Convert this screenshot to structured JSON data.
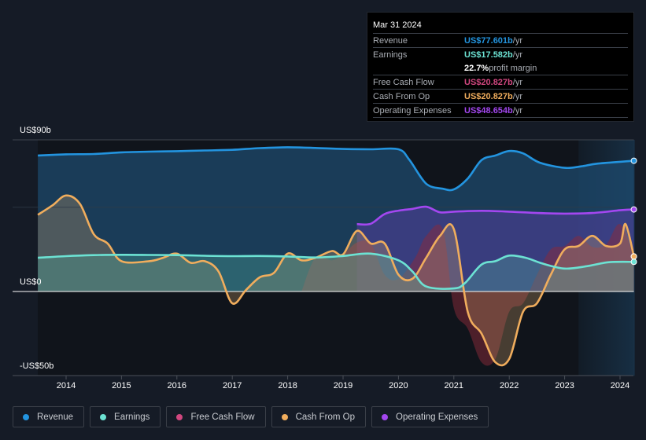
{
  "tooltip": {
    "date": "Mar 31 2024",
    "rows": [
      {
        "label": "Revenue",
        "value": "US$77.601b",
        "unit": " /yr",
        "color": "#2394df"
      },
      {
        "label": "Earnings",
        "value": "US$17.582b",
        "unit": " /yr",
        "color": "#6ce2d3"
      },
      {
        "label": "",
        "value": "22.7%",
        "unit": " profit margin",
        "color": "#ffffff"
      },
      {
        "label": "Free Cash Flow",
        "value": "US$20.827b",
        "unit": " /yr",
        "color": "#d1477f"
      },
      {
        "label": "Cash From Op",
        "value": "US$20.827b",
        "unit": " /yr",
        "color": "#f0ad5d"
      },
      {
        "label": "Operating Expenses",
        "value": "US$48.654b",
        "unit": " /yr",
        "color": "#a347f0"
      }
    ]
  },
  "legend": [
    {
      "label": "Revenue",
      "color": "#2394df"
    },
    {
      "label": "Earnings",
      "color": "#6ce2d3"
    },
    {
      "label": "Free Cash Flow",
      "color": "#d1477f"
    },
    {
      "label": "Cash From Op",
      "color": "#f0ad5d"
    },
    {
      "label": "Operating Expenses",
      "color": "#a347f0"
    }
  ],
  "chart_data": {
    "type": "area",
    "title": "",
    "xlabel": "",
    "ylabel": "",
    "ylim": [
      -50,
      90
    ],
    "xlim": [
      2013.5,
      2024.25
    ],
    "y_tick_labels": [
      {
        "value": 90,
        "label": "US$90b"
      },
      {
        "value": 0,
        "label": "US$0"
      },
      {
        "value": -50,
        "label": "-US$50b"
      }
    ],
    "x_ticks": [
      2014,
      2015,
      2016,
      2017,
      2018,
      2019,
      2020,
      2021,
      2022,
      2023,
      2024
    ],
    "x_tick_labels": [
      "2014",
      "2015",
      "2016",
      "2017",
      "2018",
      "2019",
      "2020",
      "2021",
      "2022",
      "2023",
      "2024"
    ],
    "gridlines": [
      90,
      50,
      0
    ],
    "forecast_shade_start": 2023.25,
    "legend_position": "bottom",
    "series": [
      {
        "name": "Revenue",
        "color": "#2394df",
        "points": [
          [
            2013.49,
            80.7
          ],
          [
            2014,
            81.4
          ],
          [
            2014.5,
            81.6
          ],
          [
            2015,
            82.6
          ],
          [
            2015.5,
            83
          ],
          [
            2016,
            83.3
          ],
          [
            2016.5,
            83.7
          ],
          [
            2017,
            84.1
          ],
          [
            2017.5,
            85.1
          ],
          [
            2018,
            85.6
          ],
          [
            2018.5,
            85.2
          ],
          [
            2019,
            84.6
          ],
          [
            2019.5,
            84.4
          ],
          [
            2020,
            84.4
          ],
          [
            2020.2,
            78
          ],
          [
            2020.5,
            64
          ],
          [
            2020.8,
            61
          ],
          [
            2021,
            60.6
          ],
          [
            2021.25,
            67
          ],
          [
            2021.5,
            78
          ],
          [
            2021.75,
            80.7
          ],
          [
            2022,
            83.4
          ],
          [
            2022.25,
            82
          ],
          [
            2022.55,
            76.5
          ],
          [
            2023,
            73.4
          ],
          [
            2023.3,
            74.3
          ],
          [
            2023.6,
            75.9
          ],
          [
            2024.25,
            77.6
          ]
        ]
      },
      {
        "name": "Earnings",
        "color": "#6ce2d3",
        "points": [
          [
            2013.49,
            20
          ],
          [
            2014,
            21
          ],
          [
            2014.5,
            21.6
          ],
          [
            2015,
            21.8
          ],
          [
            2015.5,
            21.7
          ],
          [
            2016,
            21.6
          ],
          [
            2016.5,
            21.2
          ],
          [
            2017,
            21
          ],
          [
            2017.5,
            21.1
          ],
          [
            2018,
            20.8
          ],
          [
            2018.5,
            20.2
          ],
          [
            2019,
            21.1
          ],
          [
            2019.5,
            22.5
          ],
          [
            2020,
            18.5
          ],
          [
            2020.25,
            12
          ],
          [
            2020.5,
            3
          ],
          [
            2021,
            1.8
          ],
          [
            2021.2,
            5
          ],
          [
            2021.5,
            16
          ],
          [
            2021.75,
            18
          ],
          [
            2022,
            21.3
          ],
          [
            2022.3,
            20
          ],
          [
            2022.6,
            16.6
          ],
          [
            2023,
            13.6
          ],
          [
            2023.4,
            15
          ],
          [
            2023.8,
            17.4
          ],
          [
            2024.25,
            17.6
          ]
        ]
      },
      {
        "name": "Free Cash Flow",
        "color": "#d1477f",
        "points": [
          [
            2018.25,
            0
          ],
          [
            2018.5,
            20
          ],
          [
            2018.8,
            18.5
          ],
          [
            2019,
            22
          ],
          [
            2019.25,
            29
          ],
          [
            2019.5,
            28.5
          ],
          [
            2019.75,
            10
          ],
          [
            2020,
            7.5
          ],
          [
            2020.3,
            20
          ],
          [
            2020.5,
            33
          ],
          [
            2020.8,
            37
          ],
          [
            2021,
            -10
          ],
          [
            2021.25,
            -22
          ],
          [
            2021.5,
            -42
          ],
          [
            2021.75,
            -40
          ],
          [
            2022,
            -12
          ],
          [
            2022.25,
            -7
          ],
          [
            2022.5,
            10
          ],
          [
            2022.75,
            25
          ],
          [
            2023,
            27
          ],
          [
            2023.25,
            33
          ],
          [
            2023.5,
            26.5
          ],
          [
            2023.75,
            28
          ],
          [
            2024,
            40
          ],
          [
            2024.25,
            20.8
          ]
        ]
      },
      {
        "name": "Cash From Op",
        "color": "#f0ad5d",
        "points": [
          [
            2013.49,
            45.5
          ],
          [
            2013.75,
            51
          ],
          [
            2014,
            57
          ],
          [
            2014.25,
            52
          ],
          [
            2014.5,
            34
          ],
          [
            2014.75,
            28.5
          ],
          [
            2015,
            18
          ],
          [
            2015.5,
            18
          ],
          [
            2015.75,
            20
          ],
          [
            2016,
            22.5
          ],
          [
            2016.25,
            17
          ],
          [
            2016.5,
            18
          ],
          [
            2016.75,
            12
          ],
          [
            2017,
            -7
          ],
          [
            2017.25,
            1
          ],
          [
            2017.5,
            8.5
          ],
          [
            2017.75,
            11
          ],
          [
            2018,
            22.5
          ],
          [
            2018.25,
            18.5
          ],
          [
            2018.5,
            20
          ],
          [
            2018.8,
            24
          ],
          [
            2019,
            22
          ],
          [
            2019.25,
            36
          ],
          [
            2019.5,
            28.5
          ],
          [
            2019.75,
            28.5
          ],
          [
            2020,
            10
          ],
          [
            2020.25,
            7.5
          ],
          [
            2020.5,
            20
          ],
          [
            2020.75,
            33
          ],
          [
            2021,
            37
          ],
          [
            2021.25,
            -12
          ],
          [
            2021.5,
            -25
          ],
          [
            2021.75,
            -42
          ],
          [
            2022,
            -40
          ],
          [
            2022.25,
            -12
          ],
          [
            2022.5,
            -7
          ],
          [
            2022.75,
            10
          ],
          [
            2023,
            25
          ],
          [
            2023.25,
            27
          ],
          [
            2023.5,
            33
          ],
          [
            2023.75,
            27
          ],
          [
            2024,
            28.5
          ],
          [
            2024.1,
            40
          ],
          [
            2024.25,
            20.8
          ]
        ]
      },
      {
        "name": "Operating Expenses",
        "color": "#a347f0",
        "points": [
          [
            2019.25,
            40
          ],
          [
            2019.5,
            40.2
          ],
          [
            2019.75,
            46
          ],
          [
            2020,
            48
          ],
          [
            2020.25,
            49
          ],
          [
            2020.5,
            50.3
          ],
          [
            2020.75,
            47
          ],
          [
            2021,
            47.4
          ],
          [
            2021.5,
            47.9
          ],
          [
            2022,
            47.4
          ],
          [
            2022.5,
            46.6
          ],
          [
            2023,
            46.2
          ],
          [
            2023.5,
            46.6
          ],
          [
            2024,
            48.2
          ],
          [
            2024.25,
            48.7
          ]
        ]
      }
    ]
  }
}
